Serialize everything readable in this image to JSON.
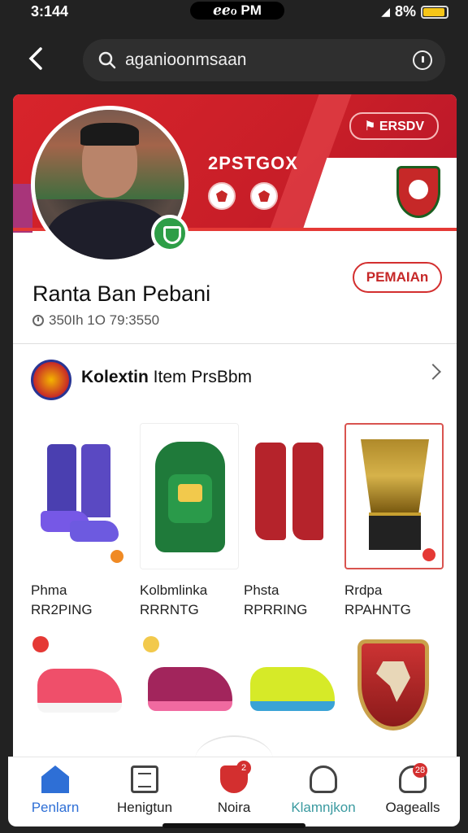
{
  "status": {
    "time": "3:144",
    "center": "ℯℯℴ PM",
    "battery_text": "8%"
  },
  "search": {
    "query": "aganioonmsaan"
  },
  "banner": {
    "badge": "ERSDV",
    "team_name": "2PSTGOX"
  },
  "profile": {
    "name": "Ranta Ban Pebani",
    "meta": "350Ih  1O 79:3550",
    "follow_label": "PEMAIAn"
  },
  "collection": {
    "title_bold": "Kolextin",
    "title_rest": " Item PrsBbm"
  },
  "items": [
    {
      "name": "Phma",
      "price": "RR2PING"
    },
    {
      "name": "Kolbmlinka",
      "price": "RRRNTG"
    },
    {
      "name": "Phsta",
      "price": "RPRRING"
    },
    {
      "name": "Rrdpa",
      "price": "RPAHNTG"
    }
  ],
  "nav": [
    {
      "label": "Penlarn",
      "icon": "home-icon"
    },
    {
      "label": "Henigtun",
      "icon": "list-icon"
    },
    {
      "label": "Noira",
      "icon": "shield-icon",
      "badge": "2"
    },
    {
      "label": "Klamnjkon",
      "icon": "person-icon"
    },
    {
      "label": "Oagealls",
      "icon": "person-icon",
      "badge": "28"
    }
  ],
  "colors": {
    "brand_red": "#d32f2f",
    "active_blue": "#2e6fd6",
    "verified_green": "#2e9e47"
  }
}
